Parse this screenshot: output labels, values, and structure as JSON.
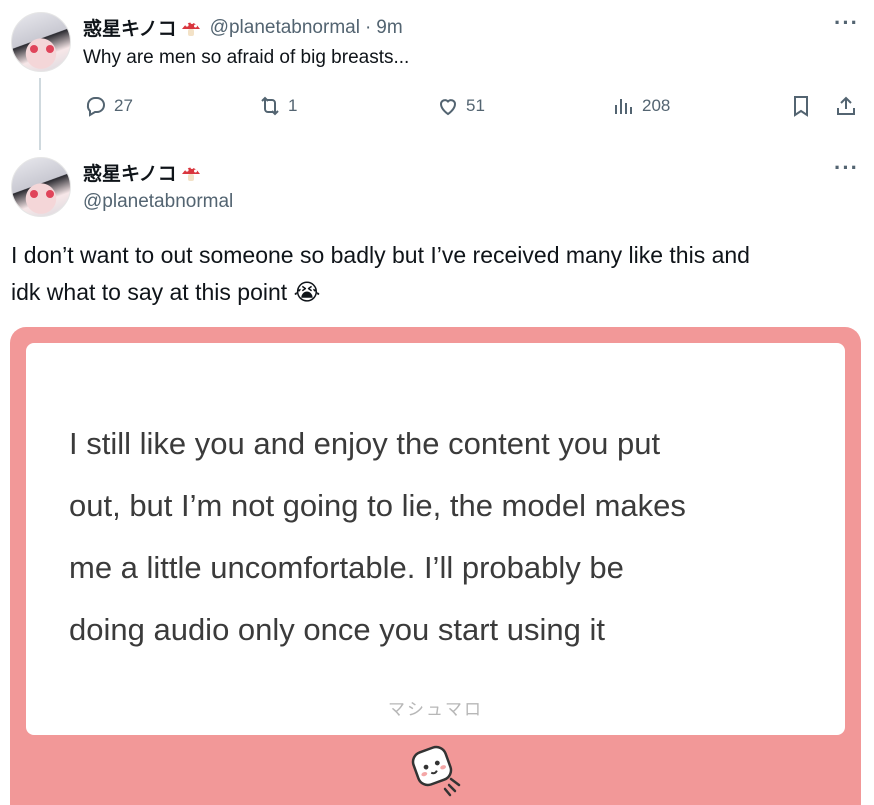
{
  "reply_tweet": {
    "display_name": "惑星キノコ",
    "handle": "@planetabnormal",
    "separator": "·",
    "time": "9m",
    "text": "Why are men so afraid of big breasts...",
    "more_icon": "more-dots-icon",
    "actions": {
      "replies": "27",
      "retweets": "1",
      "likes": "51",
      "views": "208"
    }
  },
  "main_tweet": {
    "display_name": "惑星キノコ",
    "handle": "@planetabnormal",
    "text_line1": "I don’t want to out someone so badly but I’ve received many like this and",
    "text_line2": "idk what to say at this point",
    "emoji": "😭",
    "more_icon": "more-dots-icon"
  },
  "marshmallow_card": {
    "message_lines": [
      "I still like you and enjoy the content you put",
      "out, but I’m not going to lie, the model makes",
      "me a little uncomfortable. I’ll probably be",
      "doing audio only once you start using it"
    ],
    "brand": "マシュマロ",
    "colors": {
      "frame": "#f29898",
      "inner": "#ffffff",
      "text": "#3b3b3b"
    }
  },
  "colors": {
    "muted": "#536471",
    "text": "#0f1419",
    "thread_line": "#cfd9de"
  }
}
